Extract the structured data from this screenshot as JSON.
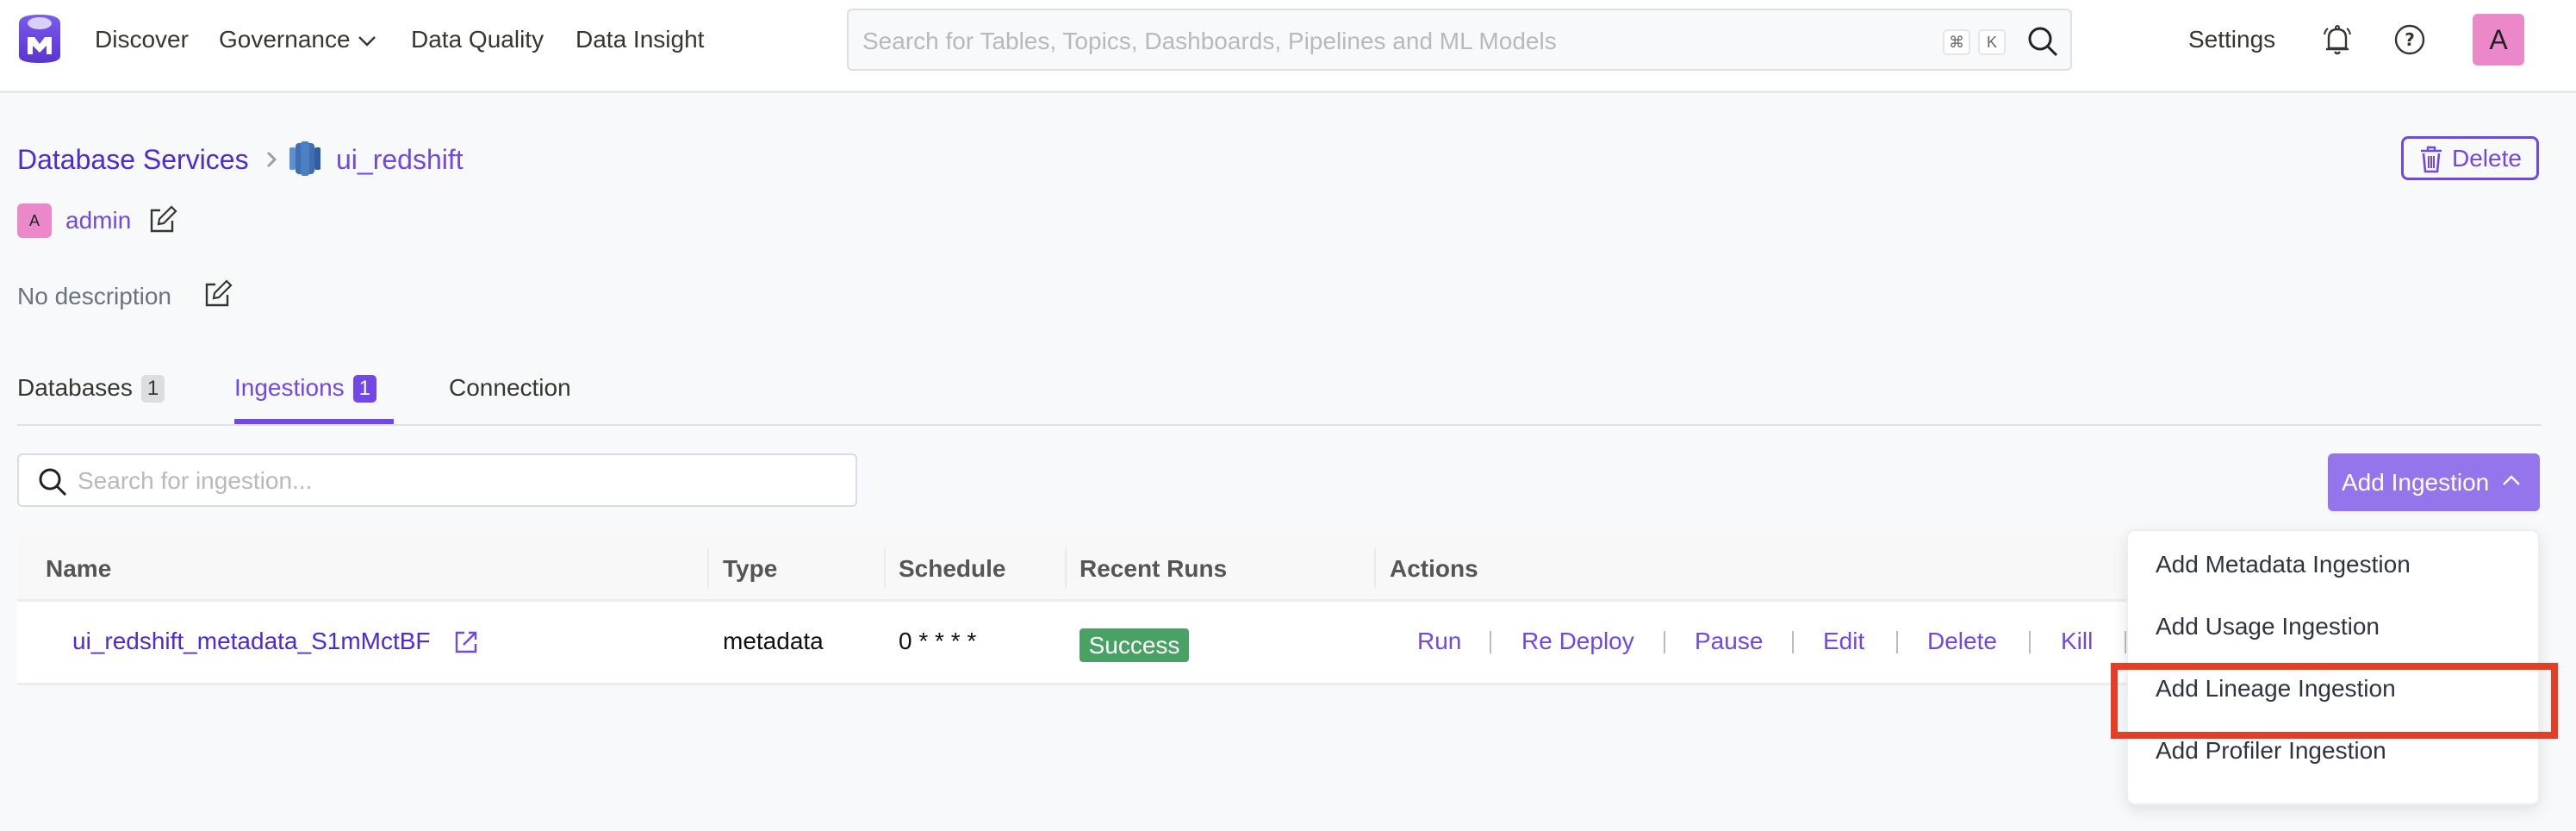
{
  "header": {
    "nav": [
      {
        "label": "Discover"
      },
      {
        "label": "Governance",
        "has_dropdown": true
      },
      {
        "label": "Data Quality"
      },
      {
        "label": "Data Insight"
      }
    ],
    "search_placeholder": "Search for Tables, Topics, Dashboards, Pipelines and ML Models",
    "shortcut_keys": [
      "⌘",
      "K"
    ],
    "settings_label": "Settings",
    "user_initial": "A"
  },
  "breadcrumb": {
    "parent": "Database Services",
    "current": "ui_redshift",
    "service_icon": "redshift-icon"
  },
  "delete_button": "Delete",
  "owner": {
    "initial": "A",
    "name": "admin"
  },
  "description": "No description",
  "tabs": [
    {
      "label": "Databases",
      "count": "1",
      "active": false
    },
    {
      "label": "Ingestions",
      "count": "1",
      "active": true
    },
    {
      "label": "Connection",
      "active": false
    }
  ],
  "ingestion_search_placeholder": "Search for ingestion...",
  "add_ingestion_button": "Add Ingestion",
  "table": {
    "columns": [
      "Name",
      "Type",
      "Schedule",
      "Recent Runs",
      "Actions"
    ],
    "rows": [
      {
        "name": "ui_redshift_metadata_S1mMctBF",
        "type": "metadata",
        "schedule": "0 * * * *",
        "recent_run": "Success",
        "actions": [
          "Run",
          "Re Deploy",
          "Pause",
          "Edit",
          "Delete",
          "Kill"
        ]
      }
    ]
  },
  "dropdown": {
    "items": [
      "Add Metadata Ingestion",
      "Add Usage Ingestion",
      "Add Lineage Ingestion",
      "Add Profiler Ingestion"
    ],
    "highlighted_index": 2
  },
  "colors": {
    "brand": "#7147e8",
    "link": "#4d2ad5",
    "success": "#48a263",
    "highlight": "#e63e25",
    "avatar": "#ea88c9"
  }
}
